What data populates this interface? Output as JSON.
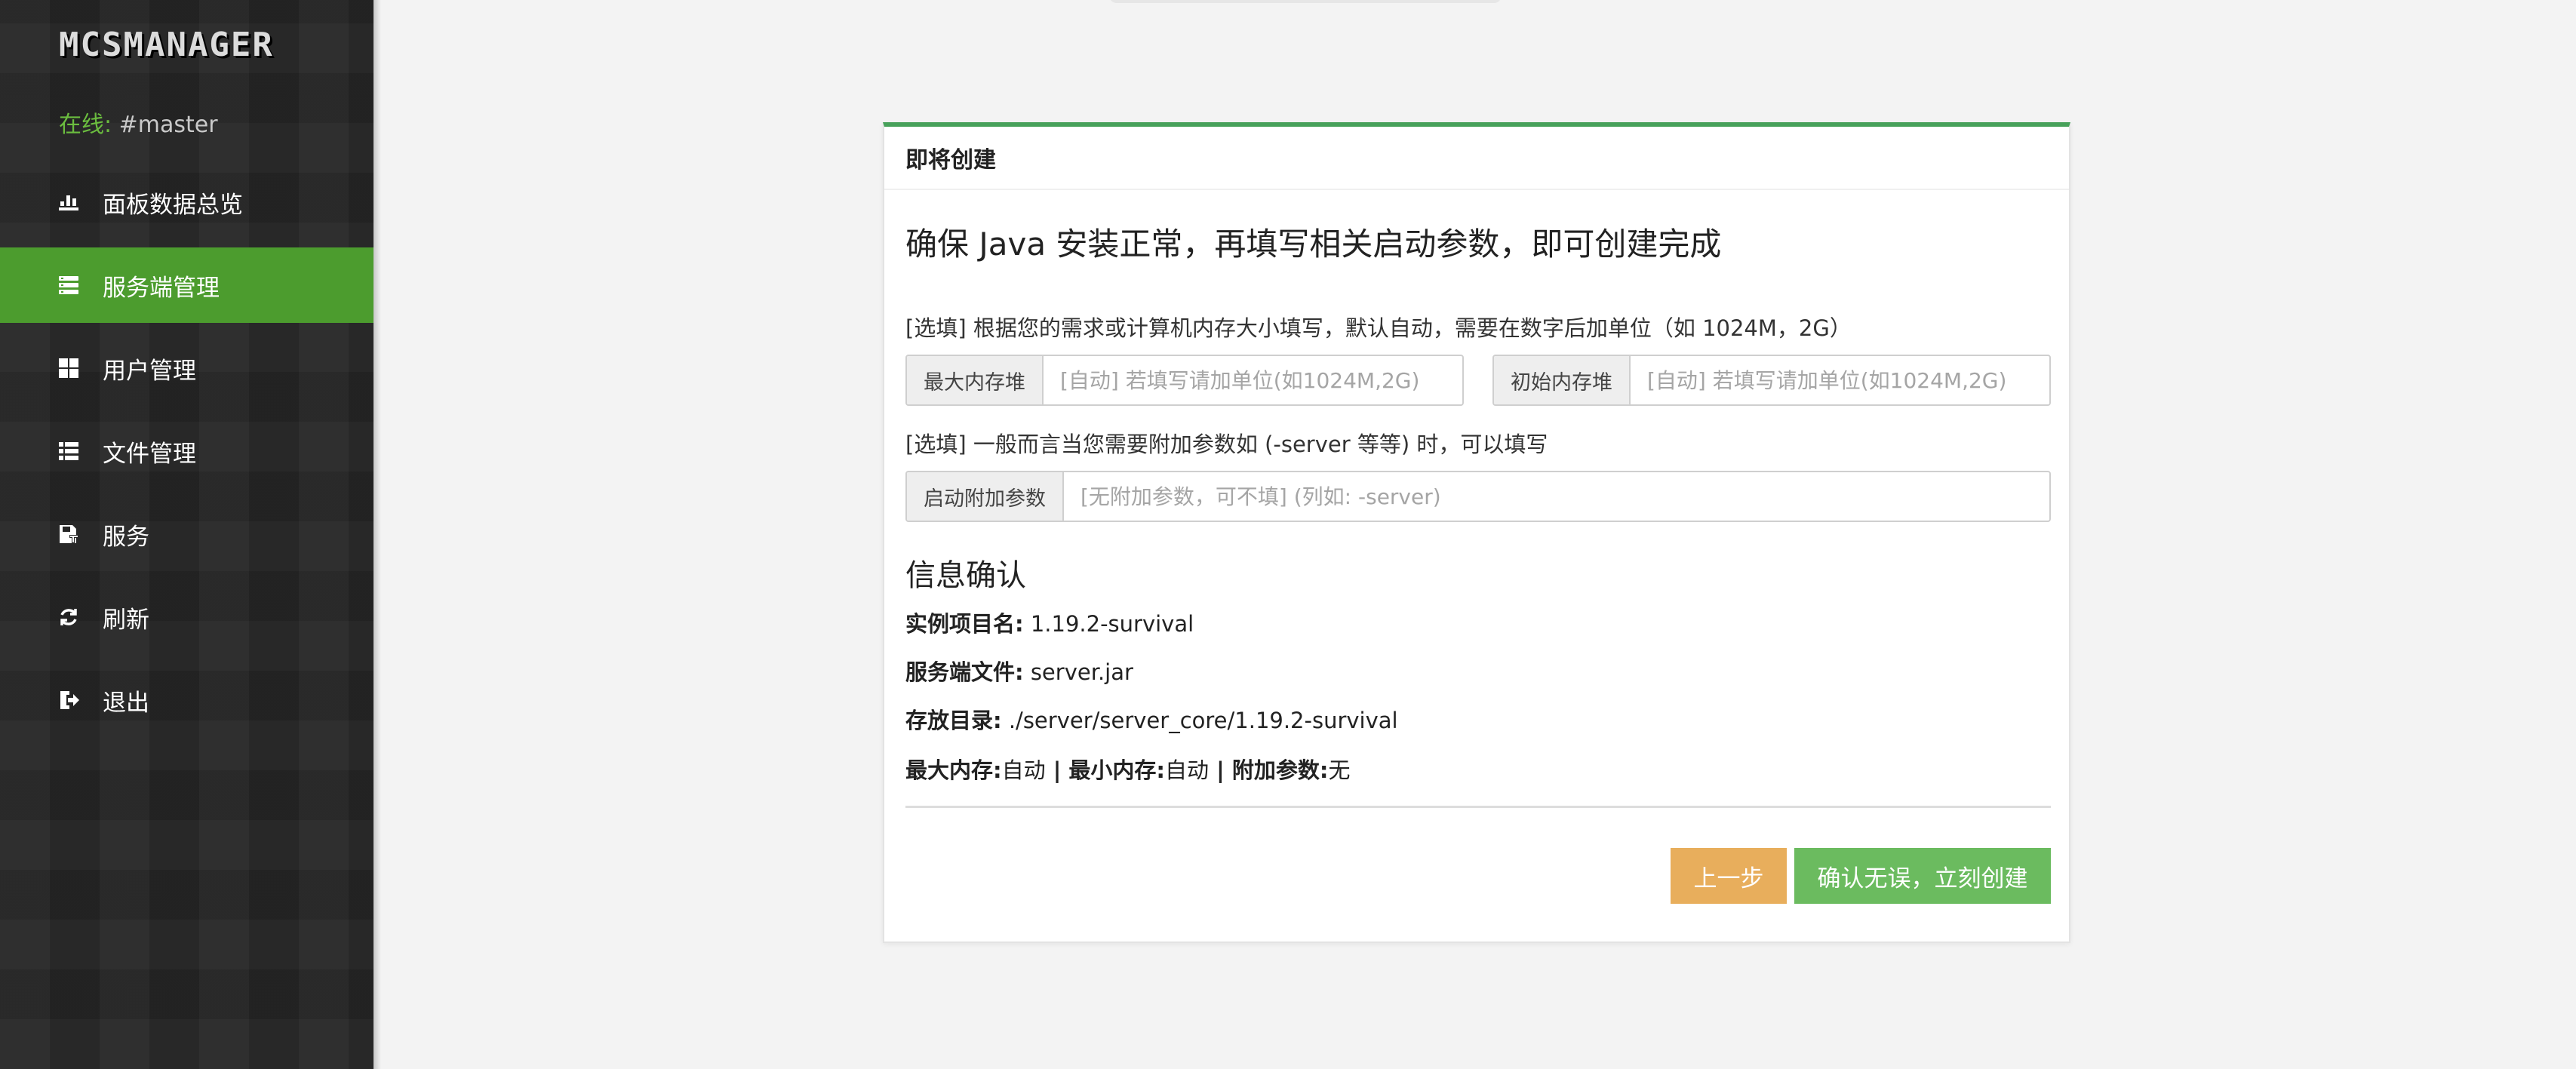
{
  "sidebar": {
    "logo": "MCSMANAGER",
    "status_prefix": "在线:",
    "status_value": " #master",
    "items": [
      {
        "label": "面板数据总览",
        "icon": "dashboard-icon"
      },
      {
        "label": "服务端管理",
        "icon": "server-list-icon",
        "active": true
      },
      {
        "label": "用户管理",
        "icon": "users-grid-icon"
      },
      {
        "label": "文件管理",
        "icon": "file-list-icon"
      },
      {
        "label": "服务",
        "icon": "service-icon"
      },
      {
        "label": "刷新",
        "icon": "refresh-icon"
      },
      {
        "label": "退出",
        "icon": "logout-icon"
      }
    ]
  },
  "card": {
    "header": "即将创建",
    "headline": "确保 Java 安装正常，再填写相关启动参数，即可创建完成",
    "hint_memory": "[选填] 根据您的需求或计算机内存大小填写，默认自动，需要在数字后加单位（如 1024M，2G）",
    "max_memory": {
      "addon": "最大内存堆",
      "placeholder": "[自动] 若填写请加单位(如1024M,2G)",
      "value": ""
    },
    "init_memory": {
      "addon": "初始内存堆",
      "placeholder": "[自动] 若填写请加单位(如1024M,2G)",
      "value": ""
    },
    "hint_extra": "[选填] 一般而言当您需要附加参数如 (-server 等等) 时，可以填写",
    "extra_args": {
      "addon": "启动附加参数",
      "placeholder": "[无附加参数，可不填] (列如: -server)",
      "value": ""
    },
    "confirm_title": "信息确认",
    "info": {
      "name_label": "实例项目名:",
      "name_value": " 1.19.2-survival",
      "jar_label": "服务端文件:",
      "jar_value": " server.jar",
      "dir_label": "存放目录:",
      "dir_value": " ./server/server_core/1.19.2-survival",
      "max_mem_label": "最大内存:",
      "max_mem_value": "自动",
      "sep": " | ",
      "min_mem_label": "最小内存:",
      "min_mem_value": "自动",
      "extra_label": "附加参数:",
      "extra_value": "无"
    },
    "btn_prev": "上一步",
    "btn_create": "确认无误，立刻创建"
  },
  "colors": {
    "sidebar_bg": "#262626",
    "active_nav": "#4c9c2e",
    "card_accent": "#47a15a",
    "prev_button": "#e8ae5c",
    "create_button": "#6bbb5f",
    "online_green": "#6bbd3f"
  }
}
